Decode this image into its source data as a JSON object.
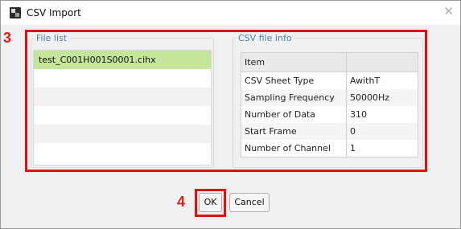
{
  "window": {
    "title": "CSV Import",
    "app_icon": "csv-import-app-icon",
    "close_icon": "close-icon"
  },
  "annotations": {
    "step3": "3",
    "step4": "4",
    "highlight_color": "#e01010"
  },
  "file_list": {
    "legend": "File list",
    "items": [
      "test_C001H001S0001.cihx",
      "",
      "",
      "",
      "",
      ""
    ],
    "selected_color": "#c4e59a"
  },
  "csv_info": {
    "legend": "CSV file info",
    "header": [
      "Item",
      ""
    ],
    "rows": [
      [
        "CSV Sheet Type",
        "AwithT"
      ],
      [
        "Sampling Frequency",
        "50000Hz"
      ],
      [
        "Number of Data",
        "310"
      ],
      [
        "Start Frame",
        "0"
      ],
      [
        "Number of Channel",
        "1"
      ]
    ]
  },
  "buttons": {
    "ok": "OK",
    "cancel": "Cancel"
  },
  "colors": {
    "legend_text": "#4a7fb5",
    "window_bg": "#f0f0f0"
  }
}
